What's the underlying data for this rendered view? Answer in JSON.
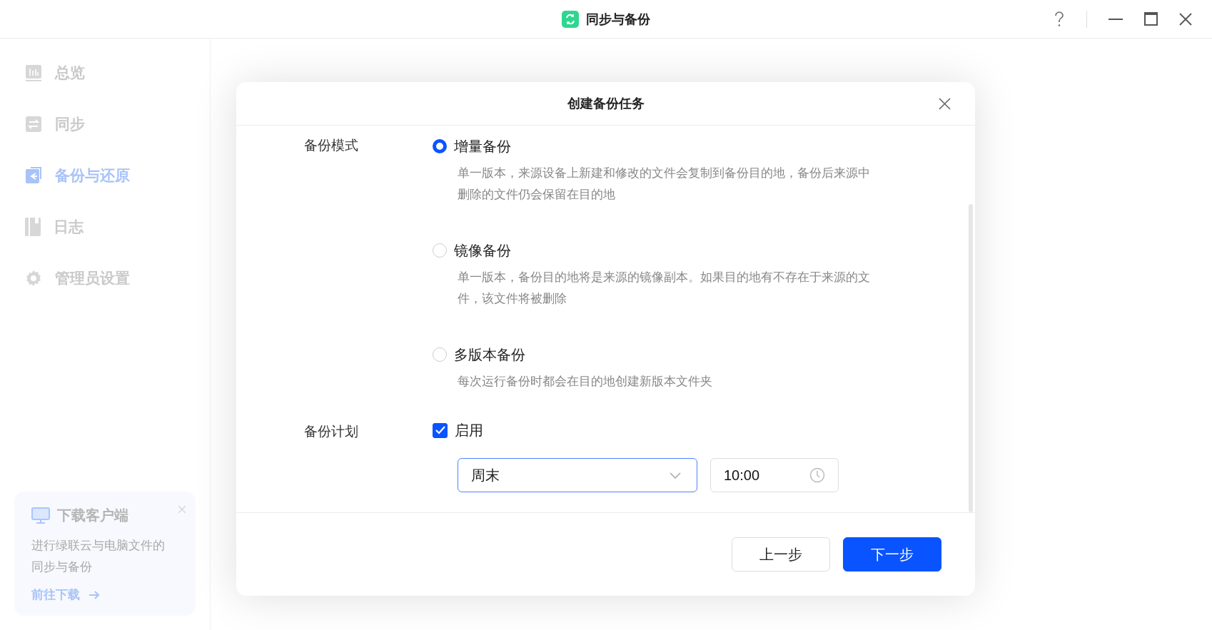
{
  "window": {
    "title": "同步与备份"
  },
  "sidebar": {
    "items": [
      {
        "label": "总览",
        "kind": "chart",
        "selected": false
      },
      {
        "label": "同步",
        "kind": "sync",
        "selected": false
      },
      {
        "label": "备份与还原",
        "kind": "backup",
        "selected": true
      },
      {
        "label": "日志",
        "kind": "log",
        "selected": false
      },
      {
        "label": "管理员设置",
        "kind": "gear",
        "selected": false
      }
    ],
    "promo": {
      "title": "下载客户端",
      "text": "进行绿联云与电脑文件的同步与备份",
      "link": "前往下载"
    }
  },
  "dialog": {
    "title": "创建备份任务",
    "mode_label": "备份模式",
    "modes": [
      {
        "label": "增量备份",
        "description": "单一版本，来源设备上新建和修改的文件会复制到备份目的地，备份后来源中删除的文件仍会保留在目的地",
        "selected": true
      },
      {
        "label": "镜像备份",
        "description": "单一版本，备份目的地将是来源的镜像副本。如果目的地有不存在于来源的文件，该文件将被删除",
        "selected": false
      },
      {
        "label": "多版本备份",
        "description": "每次运行备份时都会在目的地创建新版本文件夹",
        "selected": false
      }
    ],
    "schedule_label": "备份计划",
    "schedule_enable": {
      "label": "启用",
      "checked": true
    },
    "frequency": {
      "value": "周末"
    },
    "time": {
      "value": "10:00"
    },
    "buttons": [
      {
        "label": "上一步",
        "kind": "secondary"
      },
      {
        "label": "下一步",
        "kind": "primary"
      }
    ]
  }
}
